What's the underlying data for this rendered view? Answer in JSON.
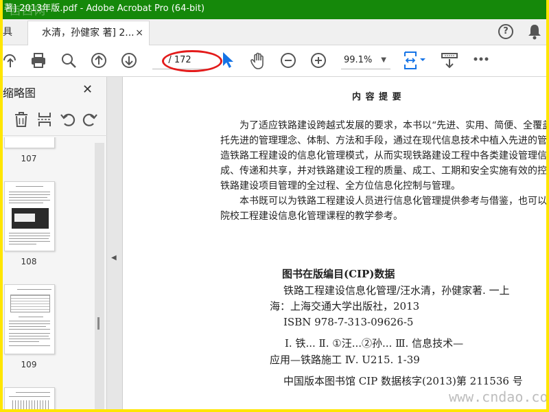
{
  "window": {
    "title": "著] 2013年版.pdf - Adobe Acrobat Pro (64-bit)",
    "watermark_top": "西西网"
  },
  "tabs": {
    "prev_label": "具",
    "active_label": "水清，孙健家 著] 2...",
    "close_glyph": "×"
  },
  "toolbar": {
    "page_value": "/ 172",
    "zoom_value": "99.1%"
  },
  "sidebar": {
    "title": "缩略图",
    "thumbnails": [
      {
        "label": "107"
      },
      {
        "label": "108"
      },
      {
        "label": "109"
      }
    ]
  },
  "document": {
    "heading": "内 容 提 要",
    "para1": [
      "为了适应铁路建设跨越式发展的要求，本书以“先进、实用、简便、全覆盖”为原则，借",
      "托先进的管理理念、体制、方法和手段，通过在现代信息技术中植入先进的管理理念，构",
      "造铁路工程建设的信息化管理模式，从而实现铁路建设工程中各类建设管理信息的集",
      "成、传递和共享，并对铁路建设工程的质量、成工、工期和安全实施有效的控制，进而实现",
      "铁路建设项目管理的全过程、全方位信息化控制与管理。"
    ],
    "para2": [
      "本书既可以为铁路工程建设人员进行信息化管理提供参考与借鉴，也可以作为高等",
      "院校工程建设信息化管理课程的教学参考。"
    ],
    "cip_title": "图书在版编目(CIP)数据",
    "cip_lines": [
      "铁路工程建设信息化管理/汪水清，孙健家著. 一上",
      "海：上海交通大学出版社，2013",
      "ISBN 978-7-313-09626-5"
    ],
    "cip_class": [
      "Ⅰ. 铁...    Ⅱ. ①汪...②孙...    Ⅲ. 信息技术—",
      "应用—铁路施工    Ⅳ. U215. 1-39"
    ],
    "cip_footer": "中国版本图书馆 CIP 数据核字(2013)第 211536 号"
  },
  "watermark": "www.cndao.com",
  "colors": {
    "titlebar": "#15880a",
    "frame": "#ffe600",
    "highlight_ellipse": "#e31b1b",
    "cursor_blue": "#1473e6"
  }
}
